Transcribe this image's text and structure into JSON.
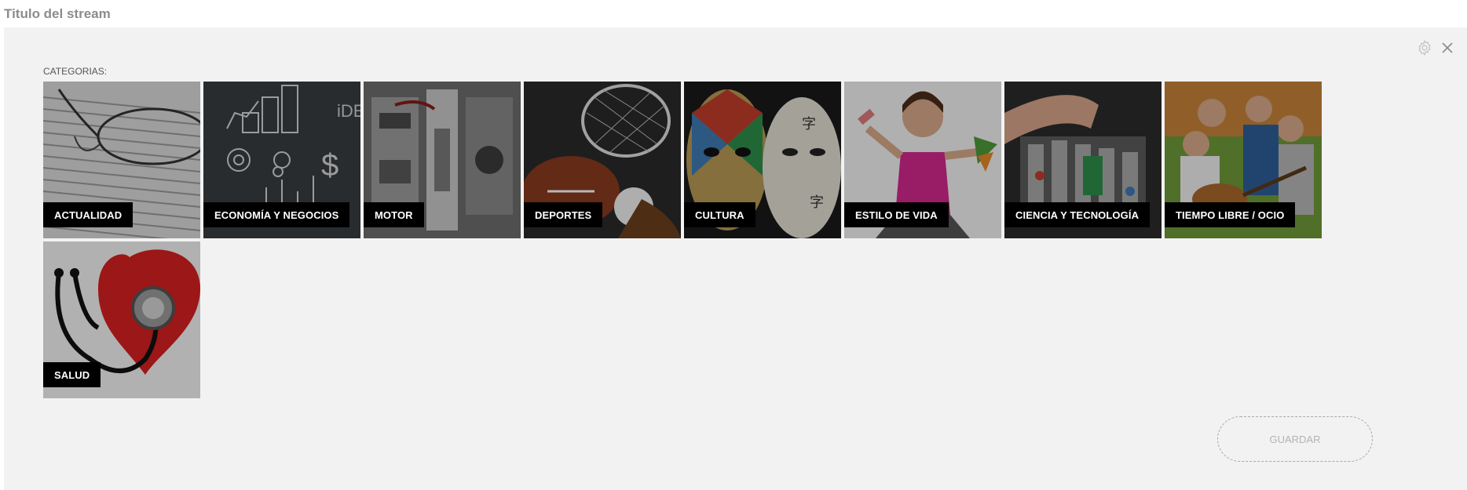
{
  "header": {
    "title": "Titulo del stream"
  },
  "panel": {
    "categories_label": "CATEGORIAS:",
    "categories": [
      {
        "label": "ACTUALIDAD",
        "name": "actualidad"
      },
      {
        "label": "ECONOMÍA Y NEGOCIOS",
        "name": "economia-y-negocios"
      },
      {
        "label": "MOTOR",
        "name": "motor"
      },
      {
        "label": "DEPORTES",
        "name": "deportes"
      },
      {
        "label": "CULTURA",
        "name": "cultura"
      },
      {
        "label": "ESTILO DE VIDA",
        "name": "estilo-de-vida"
      },
      {
        "label": "CIENCIA Y TECNOLOGÍA",
        "name": "ciencia-y-tecnologia"
      },
      {
        "label": "TIEMPO LIBRE / OCIO",
        "name": "tiempo-libre-ocio"
      },
      {
        "label": "SALUD",
        "name": "salud"
      }
    ],
    "save_label": "GUARDAR",
    "icons": {
      "settings": "gear-icon",
      "close": "close-icon"
    }
  }
}
